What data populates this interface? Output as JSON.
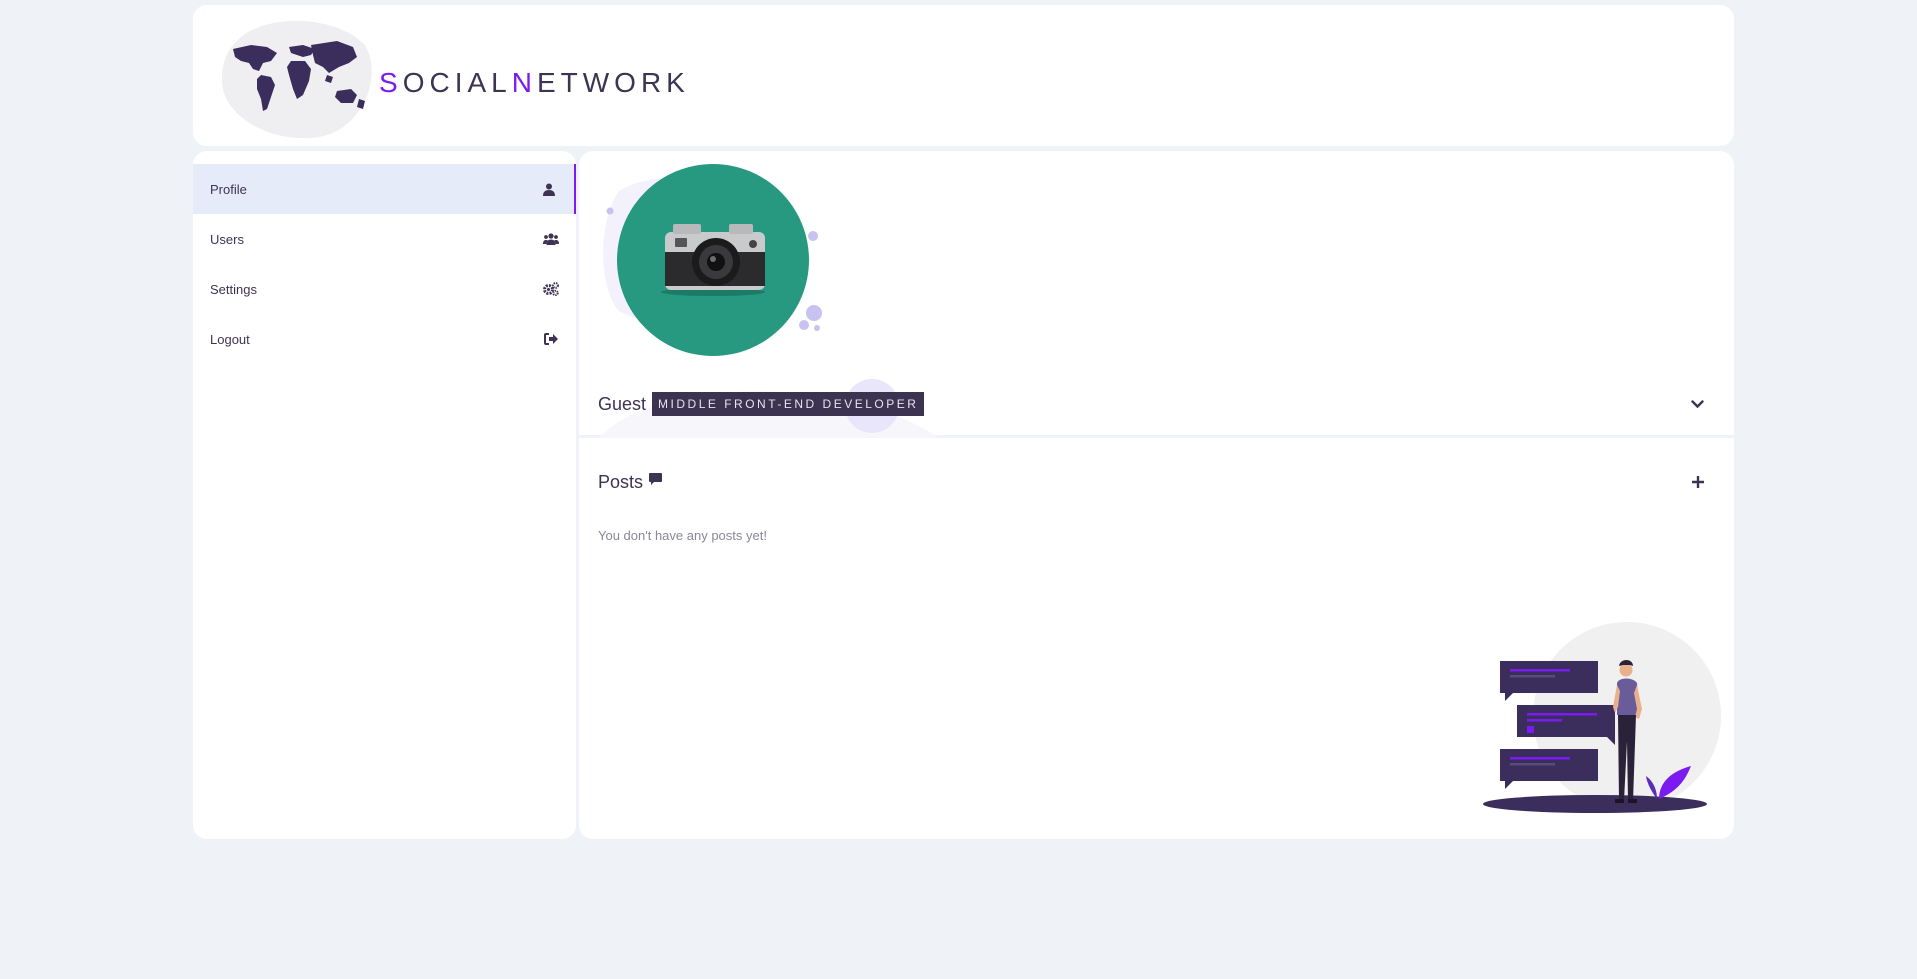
{
  "header": {
    "logo_text_parts": [
      "S",
      "OCIAL",
      "N",
      "ETWORK"
    ],
    "logo_icon": "world-map-icon"
  },
  "sidebar": {
    "items": [
      {
        "label": "Profile",
        "icon": "user-icon",
        "active": true
      },
      {
        "label": "Users",
        "icon": "users-icon",
        "active": false
      },
      {
        "label": "Settings",
        "icon": "gears-icon",
        "active": false
      },
      {
        "label": "Logout",
        "icon": "sign-out-icon",
        "active": false
      }
    ]
  },
  "profile": {
    "avatar_icon": "camera-image",
    "name": "Guest",
    "role": "MIDDLE FRONT-END DEVELOPER",
    "expand_icon": "chevron-down-icon"
  },
  "posts": {
    "title": "Posts",
    "title_icon": "comment-icon",
    "add_icon": "plus-icon",
    "empty_message": "You don't have any posts yet!"
  },
  "colors": {
    "background": "#eff3f7",
    "accent": "#7b1bf0",
    "text_dark": "#3d3452",
    "active_nav": "#e6ebfa",
    "avatar_bg": "#269980"
  }
}
